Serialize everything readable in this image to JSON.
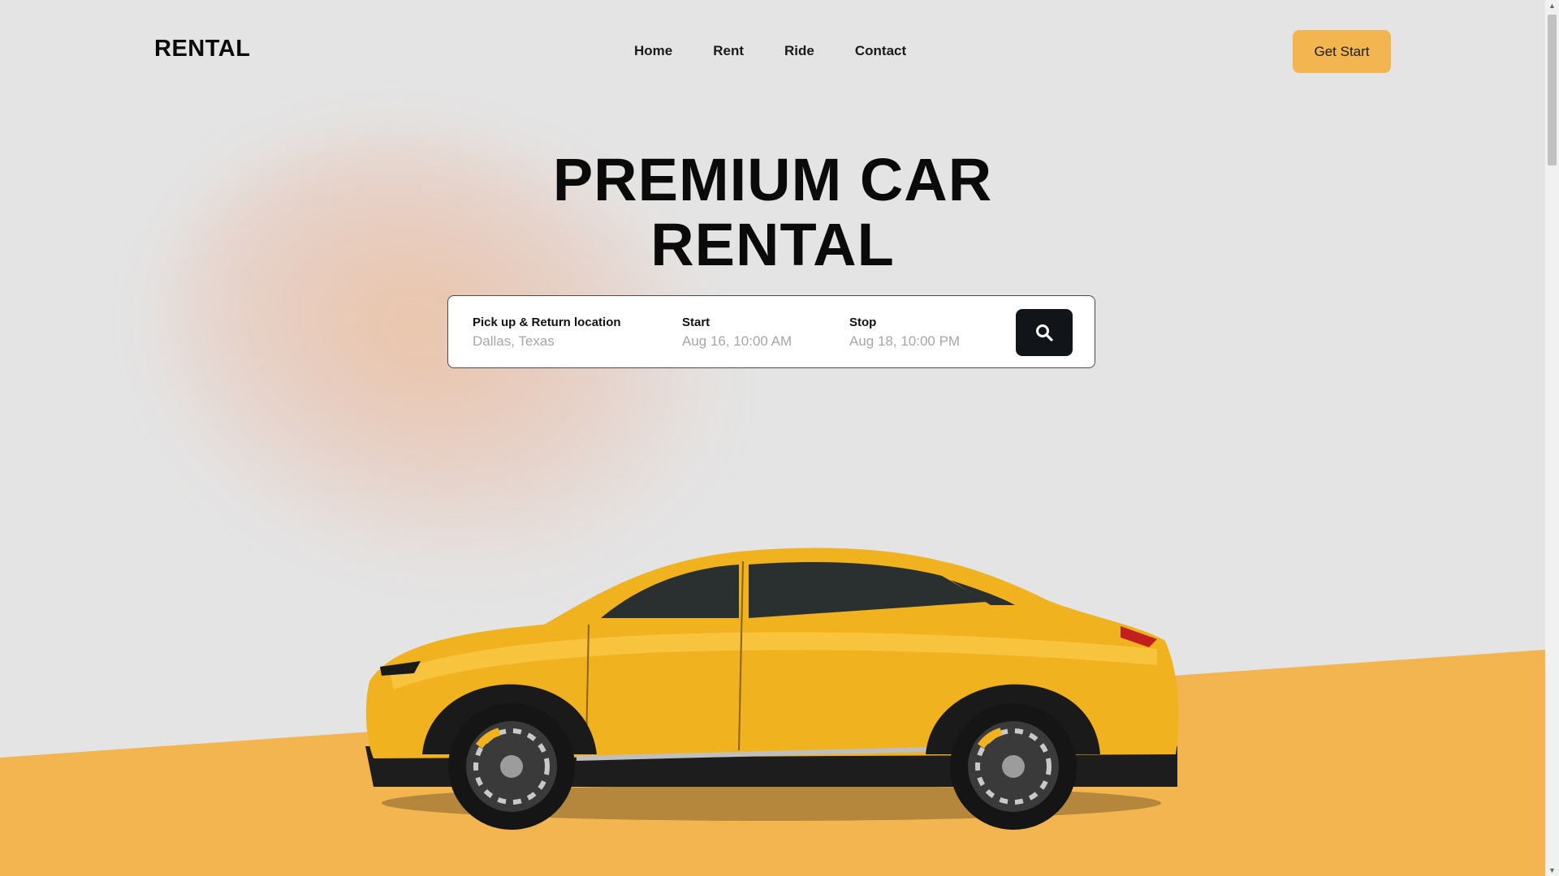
{
  "brand": "RENTAL",
  "nav": {
    "home": "Home",
    "rent": "Rent",
    "ride": "Ride",
    "contact": "Contact"
  },
  "cta_label": "Get Start",
  "hero": {
    "line1": "PREMIUM CAR",
    "line2": "RENTAL"
  },
  "search": {
    "location": {
      "label": "Pick up & Return location",
      "value": "Dallas, Texas"
    },
    "start": {
      "label": "Start",
      "value": "Aug 16, 10:00 AM"
    },
    "stop": {
      "label": "Stop",
      "value": "Aug 18, 10:00 PM"
    },
    "button_icon": "search-icon"
  },
  "hero_image": "yellow-suv-car",
  "colors": {
    "accent": "#f2b550",
    "background": "#e4e4e4",
    "dark": "#111418",
    "car_body": "#f0b21e"
  }
}
